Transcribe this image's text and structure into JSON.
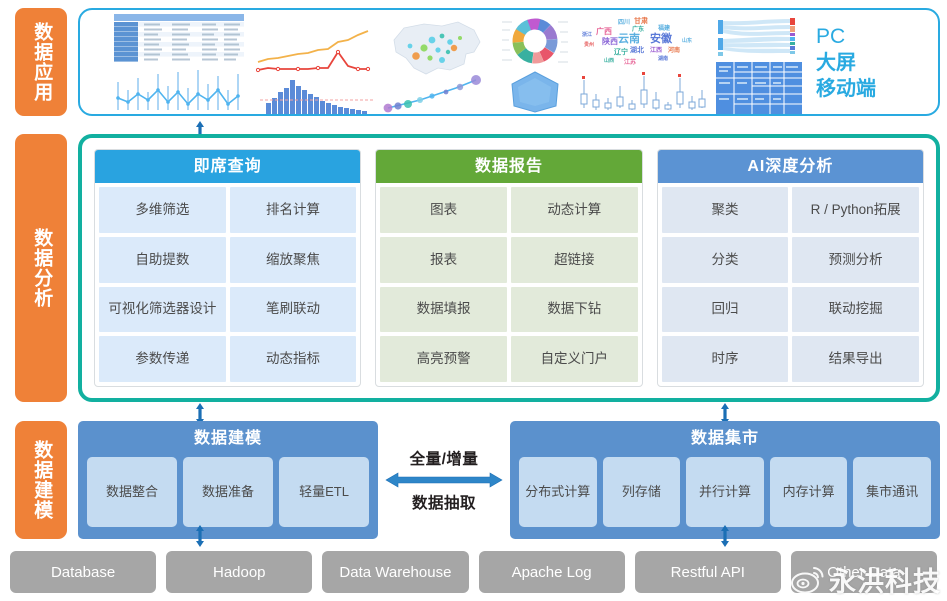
{
  "sidebar": {
    "items": [
      {
        "label": "数据应用"
      },
      {
        "label": "数据分析"
      },
      {
        "label": "数据建模"
      }
    ]
  },
  "application_layer": {
    "devices": [
      "PC",
      "大屏",
      "移动端"
    ],
    "thumbnails": [
      {
        "name": "table-chart-thumb"
      },
      {
        "name": "column-line-chart-thumb"
      },
      {
        "name": "dual-line-chart-thumb"
      },
      {
        "name": "histogram-chart-thumb"
      },
      {
        "name": "china-map-bubble-thumb"
      },
      {
        "name": "bubble-trend-thumb"
      },
      {
        "name": "donut-chart-thumb"
      },
      {
        "name": "radar-chart-thumb"
      },
      {
        "name": "word-cloud-thumb"
      },
      {
        "name": "box-plot-thumb"
      },
      {
        "name": "sankey-diagram-thumb"
      },
      {
        "name": "treemap-chart-thumb"
      }
    ]
  },
  "analysis_layer": {
    "cards": [
      {
        "title": "即席查询",
        "header_color": "#29a3e0",
        "cell_color": "#dbeafa",
        "cells": [
          "多维筛选",
          "排名计算",
          "自助提数",
          "缩放聚焦",
          "可视化筛选器设计",
          "笔刷联动",
          "参数传递",
          "动态指标"
        ]
      },
      {
        "title": "数据报告",
        "header_color": "#63a838",
        "cell_color": "#e2eada",
        "cells": [
          "图表",
          "动态计算",
          "报表",
          "超链接",
          "数据填报",
          "数据下钻",
          "高亮预警",
          "自定义门户"
        ]
      },
      {
        "title": "AI深度分析",
        "header_color": "#5b93d3",
        "cell_color": "#dfe7f2",
        "cells": [
          "聚类",
          "R / Python拓展",
          "分类",
          "预测分析",
          "回归",
          "联动挖掘",
          "时序",
          "结果导出"
        ]
      }
    ]
  },
  "modeling_layer": {
    "left": {
      "title": "数据建模",
      "chips": [
        "数据整合",
        "数据准备",
        "轻量ETL"
      ]
    },
    "right": {
      "title": "数据集市",
      "chips": [
        "分布式计算",
        "列存储",
        "并行计算",
        "内存计算",
        "集市通讯"
      ]
    },
    "arrow": {
      "top_label": "全量/增量",
      "bottom_label": "数据抽取"
    }
  },
  "sources": [
    {
      "label": "Database"
    },
    {
      "label": "Hadoop"
    },
    {
      "label": "Data Warehouse"
    },
    {
      "label": "Apache Log"
    },
    {
      "label": "Restful API"
    },
    {
      "label": "Other Data"
    }
  ],
  "watermark": {
    "text": "永洪科技"
  },
  "colors": {
    "orange": "#ef8138",
    "teal": "#12b0a0",
    "blue": "#29aae1",
    "model_blue": "#5b91cd",
    "gray": "#a6a6a6"
  }
}
